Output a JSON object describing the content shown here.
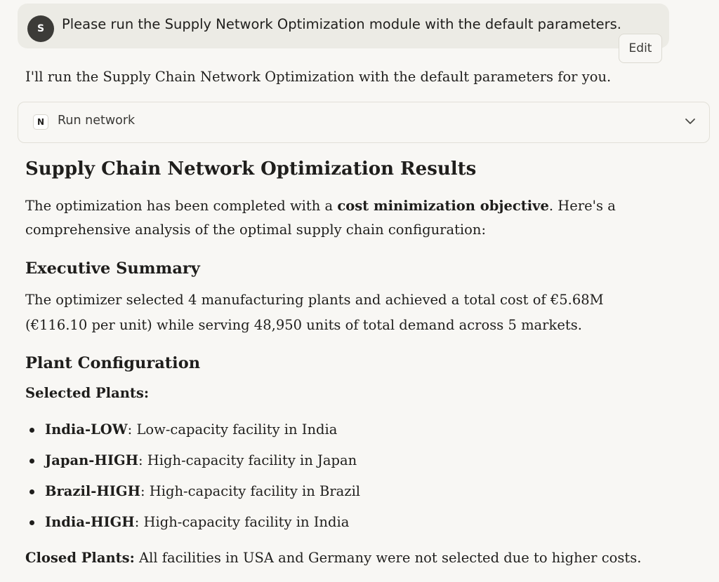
{
  "user_message": {
    "avatar_initial": "S",
    "text": "Please run the Supply Network Optimization module with the default parameters.",
    "edit_label": "Edit"
  },
  "assistant": {
    "intro": "I'll run the Supply Chain Network Optimization with the default parameters for you.",
    "tool_call": {
      "icon_letter": "N",
      "label": "Run network",
      "icon": "chevron-down-icon"
    },
    "heading": "Supply Chain Network Optimization Results",
    "summary_p1_pre": "The optimization has been completed with a ",
    "summary_p1_bold": "cost minimization objective",
    "summary_p1_post": ". Here's a",
    "summary_p2": "comprehensive analysis of the optimal supply chain configuration:",
    "exec_heading": "Executive Summary",
    "exec_line1": "The optimizer selected 4 manufacturing plants and achieved a total cost of €5.68M",
    "exec_line2": "(€116.10 per unit) while serving 48,950 units of total demand across 5 markets.",
    "plant_heading": "Plant Configuration",
    "selected_label": "Selected Plants:",
    "plants": [
      {
        "name": "India-LOW",
        "desc": ": Low-capacity facility in India"
      },
      {
        "name": "Japan-HIGH",
        "desc": ": High-capacity facility in Japan"
      },
      {
        "name": "Brazil-HIGH",
        "desc": ": High-capacity facility in Brazil"
      },
      {
        "name": "India-HIGH",
        "desc": ": High-capacity facility in India"
      }
    ],
    "closed_label": "Closed Plants:",
    "closed_text": " All facilities in USA and Germany were not selected due to higher costs."
  }
}
